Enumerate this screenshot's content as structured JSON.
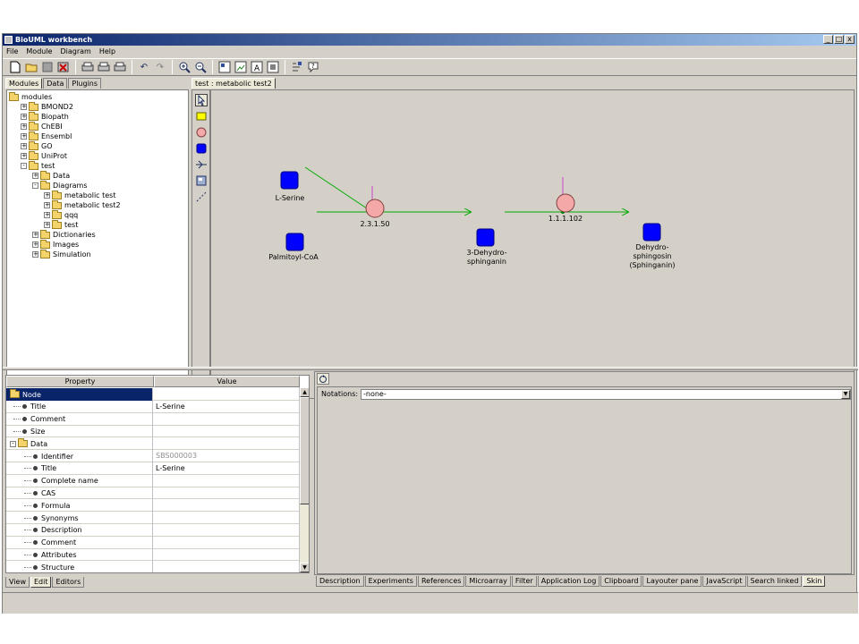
{
  "window": {
    "title": "BioUML workbench",
    "controls": [
      "_",
      "□",
      "x"
    ]
  },
  "menu": [
    "File",
    "Module",
    "Diagram",
    "Help"
  ],
  "left_tabs": [
    "Modules",
    "Data",
    "Plugins"
  ],
  "tree": [
    {
      "label": "modules",
      "level": 0,
      "expander": ""
    },
    {
      "label": "BMOND2",
      "level": 1,
      "expander": "+"
    },
    {
      "label": "Biopath",
      "level": 1,
      "expander": "+"
    },
    {
      "label": "ChEBI",
      "level": 1,
      "expander": "+"
    },
    {
      "label": "Ensembl",
      "level": 1,
      "expander": "+"
    },
    {
      "label": "GO",
      "level": 1,
      "expander": "+"
    },
    {
      "label": "UniProt",
      "level": 1,
      "expander": "+"
    },
    {
      "label": "test",
      "level": 1,
      "expander": "-"
    },
    {
      "label": "Data",
      "level": 2,
      "expander": "+"
    },
    {
      "label": "Diagrams",
      "level": 2,
      "expander": "-"
    },
    {
      "label": "metabolic test",
      "level": 3,
      "expander": "+"
    },
    {
      "label": "metabolic test2",
      "level": 3,
      "expander": "+"
    },
    {
      "label": "qqq",
      "level": 3,
      "expander": "+"
    },
    {
      "label": "test",
      "level": 3,
      "expander": "+"
    },
    {
      "label": "Dictionaries",
      "level": 2,
      "expander": "+"
    },
    {
      "label": "Images",
      "level": 2,
      "expander": "+"
    },
    {
      "label": "Simulation",
      "level": 2,
      "expander": "+"
    }
  ],
  "diagram": {
    "tab_label": "test : metabolic test2",
    "nodes": {
      "l_serine": "L-Serine",
      "palmitoyl": "Palmitoyl-CoA",
      "dehydro_line1": "3-Dehydro-",
      "dehydro_line2": "sphinganin",
      "dehydrosph_line1": "Dehydro-",
      "dehydrosph_line2": "sphingosin",
      "dehydrosph_line3": "(Sphinganin)",
      "enzyme1": "2.3.1.50",
      "enzyme2": "1.1.1.102"
    },
    "colors": {
      "species": "#0000ff",
      "enzyme": "#f4a8a8",
      "reaction_edge": "#00aa00",
      "modifier_edge": "#cc44cc"
    }
  },
  "properties": {
    "header_property": "Property",
    "header_value": "Value",
    "rows": [
      {
        "name": "Node",
        "value": "",
        "kind": "folder-open",
        "selected": true
      },
      {
        "name": "Title",
        "value": "L-Serine",
        "kind": "leaf1"
      },
      {
        "name": "Comment",
        "value": "",
        "kind": "leaf1"
      },
      {
        "name": "Size",
        "value": "",
        "kind": "leaf1"
      },
      {
        "name": "Data",
        "value": "",
        "kind": "folder-sub"
      },
      {
        "name": "Identifier",
        "value": "SBS000003",
        "kind": "leaf2",
        "grey": true
      },
      {
        "name": "Title",
        "value": "L-Serine",
        "kind": "leaf2"
      },
      {
        "name": "Complete name",
        "value": "",
        "kind": "leaf2"
      },
      {
        "name": "CAS",
        "value": "",
        "kind": "leaf2"
      },
      {
        "name": "Formula",
        "value": "",
        "kind": "leaf2"
      },
      {
        "name": "Synonyms",
        "value": "",
        "kind": "leaf2"
      },
      {
        "name": "Description",
        "value": "",
        "kind": "leaf2"
      },
      {
        "name": "Comment",
        "value": "",
        "kind": "leaf2"
      },
      {
        "name": "Attributes",
        "value": "",
        "kind": "leaf2"
      },
      {
        "name": "Structure",
        "value": "",
        "kind": "leaf2"
      }
    ]
  },
  "left_bottom_tabs": [
    "View",
    "Edit",
    "Editors"
  ],
  "notations": {
    "label": "Notations:",
    "value": "-none-"
  },
  "right_bottom_tabs": [
    "Description",
    "Experiments",
    "References",
    "Microarray",
    "Filter",
    "Application Log",
    "Clipboard",
    "Layouter pane",
    "JavaScript",
    "Search linked",
    "Skin"
  ]
}
